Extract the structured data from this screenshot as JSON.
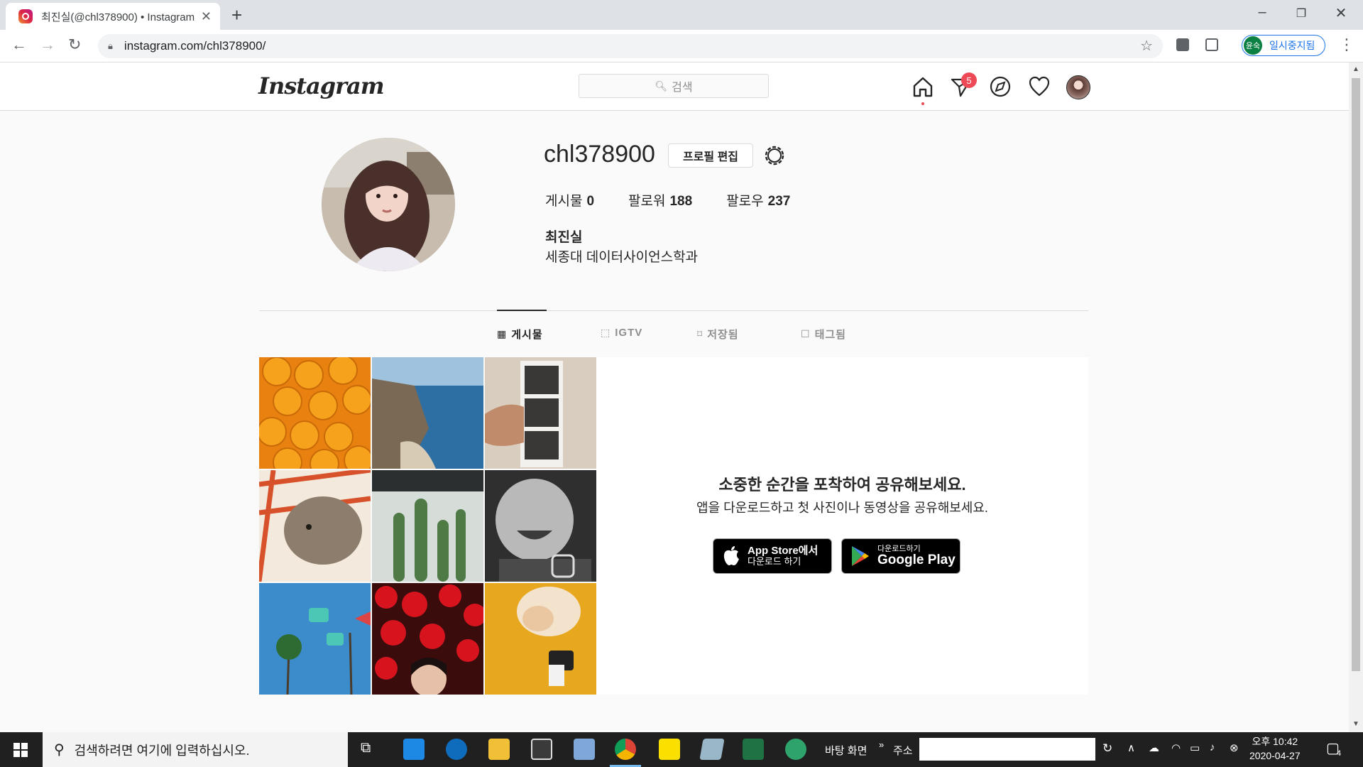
{
  "browser": {
    "tab_title": "최진실(@chl378900) • Instagram",
    "url": "instagram.com/chl378900/",
    "profile_avatar_text": "윤숙",
    "profile_status": "일시중지됨"
  },
  "ig": {
    "logo": "Instagram",
    "search_placeholder": "검색",
    "direct_badge": "5"
  },
  "profile": {
    "username": "chl378900",
    "edit_button": "프로필 편집",
    "stats": {
      "posts_label": "게시물",
      "posts": "0",
      "followers_label": "팔로워",
      "followers": "188",
      "following_label": "팔로우",
      "following": "237"
    },
    "full_name": "최진실",
    "bio": "세종대 데이터사이언스학과"
  },
  "tabs": [
    {
      "label": "게시물",
      "icon": "grid-icon",
      "active": true
    },
    {
      "label": "IGTV",
      "icon": "igtv-icon",
      "active": false
    },
    {
      "label": "저장됨",
      "icon": "bookmark-icon",
      "active": false
    },
    {
      "label": "태그됨",
      "icon": "tag-person-icon",
      "active": false
    }
  ],
  "empty_state": {
    "title": "소중한 순간을 포착하여 공유해보세요.",
    "subtitle": "앱을 다운로드하고 첫 사진이나 동영상을 공유해보세요.",
    "app_store_line1": "App Store에서",
    "app_store_line2": "다운로드 하기",
    "google_play_line1": "다운로드하기",
    "google_play_line2": "Google Play"
  },
  "taskbar": {
    "search_placeholder": "검색하려면 여기에 입력하십시오.",
    "desktop_label": "바탕 화면",
    "address_label": "주소",
    "time": "오후 10:42",
    "date": "2020-04-27",
    "notification_count": "4"
  },
  "colors": {
    "badge": "#ed4956",
    "chrome_accent": "#1a73e8",
    "taskbar": "#202020"
  }
}
